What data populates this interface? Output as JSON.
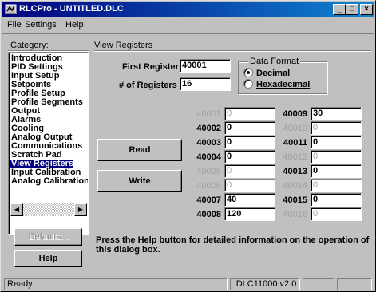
{
  "window": {
    "title": "RLCPro - UNTITLED.DLC",
    "minimize_label": "_",
    "maximize_label": "□",
    "close_label": "×"
  },
  "menu": {
    "file": "File",
    "settings": "Settings",
    "help": "Help"
  },
  "category": {
    "heading": "Category:",
    "items": [
      "Introduction",
      "PID Settings",
      "Input Setup",
      "Setpoints",
      "Profile Setup",
      "Profile Segments",
      "Output",
      "Alarms",
      "Cooling",
      "Analog Output",
      "Communications",
      "Scratch Pad",
      "View Registers",
      "Input Calibration",
      "Analog Calibration"
    ],
    "selected": "View Registers"
  },
  "panel": {
    "heading": "View Registers",
    "first_register_label": "First Register",
    "first_register_value": "40001",
    "num_registers_label": "# of Registers",
    "num_registers_value": "16"
  },
  "data_format": {
    "title": "Data Format",
    "decimal_label": "Decimal",
    "hex_label": "Hexadecimal",
    "selected": "Decimal"
  },
  "buttons": {
    "read": "Read",
    "write": "Write",
    "defaults": "Defaults...",
    "help": "Help"
  },
  "registers_left": [
    {
      "name": "40001",
      "value": "0",
      "enabled": false
    },
    {
      "name": "40002",
      "value": "0",
      "enabled": true
    },
    {
      "name": "40003",
      "value": "0",
      "enabled": true
    },
    {
      "name": "40004",
      "value": "0",
      "enabled": true
    },
    {
      "name": "40005",
      "value": "0",
      "enabled": false
    },
    {
      "name": "40006",
      "value": "0",
      "enabled": false
    },
    {
      "name": "40007",
      "value": "40",
      "enabled": true
    },
    {
      "name": "40008",
      "value": "120",
      "enabled": true
    }
  ],
  "registers_right": [
    {
      "name": "40009",
      "value": "30",
      "enabled": true
    },
    {
      "name": "40010",
      "value": "0",
      "enabled": false
    },
    {
      "name": "40011",
      "value": "0",
      "enabled": true
    },
    {
      "name": "40012",
      "value": "0",
      "enabled": false
    },
    {
      "name": "40013",
      "value": "0",
      "enabled": true
    },
    {
      "name": "40014",
      "value": "0",
      "enabled": false
    },
    {
      "name": "40015",
      "value": "0",
      "enabled": true
    },
    {
      "name": "40016",
      "value": "0",
      "enabled": false
    }
  ],
  "help_text": "Press the Help button for detailed information on the operation of this dialog box.",
  "status": {
    "message": "Ready",
    "version": "DLC11000 v2.0"
  },
  "colors": {
    "title_bar": "#000080",
    "selection": "#000080",
    "face": "#c0c0c0",
    "disabled_text": "#a0a0a0"
  }
}
